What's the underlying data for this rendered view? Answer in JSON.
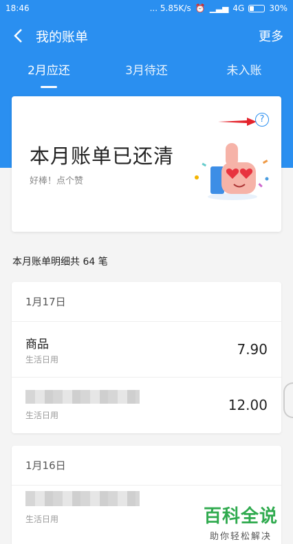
{
  "status_bar": {
    "time": "18:46",
    "network_speed": "... 5.85K/s",
    "network_type": "4G",
    "battery": "30%",
    "battery_level": 0.3
  },
  "topbar": {
    "title": "我的账单",
    "more_label": "更多"
  },
  "tabs": [
    {
      "label": "2月应还",
      "active": true
    },
    {
      "label": "3月待还",
      "active": false
    },
    {
      "label": "未入账",
      "active": false
    }
  ],
  "summary_card": {
    "headline": "本月账单已还清",
    "subtext": "好棒！点个赞"
  },
  "detail_count": "本月账单明细共 64 笔",
  "groups": [
    {
      "date": "1月17日",
      "items": [
        {
          "name": "商品",
          "category": "生活日用",
          "amount": "7.90"
        },
        {
          "name": "",
          "category": "生活日用",
          "amount": "12.00"
        }
      ]
    },
    {
      "date": "1月16日",
      "items": [
        {
          "name": "",
          "category": "生活日用",
          "amount": ""
        }
      ]
    }
  ],
  "watermark": {
    "main": "百科全说",
    "sub": "助你轻松解决"
  },
  "colors": {
    "brand": "#2a8ff0",
    "arrow": "#e3232c",
    "watermark": "#2faa4e"
  }
}
